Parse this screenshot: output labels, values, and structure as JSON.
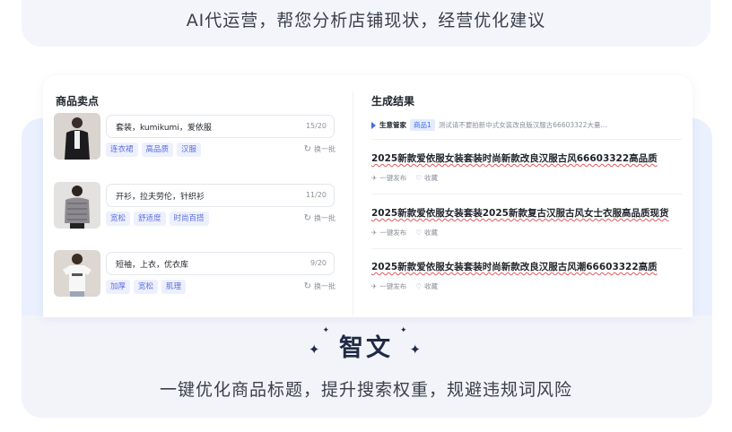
{
  "header": {
    "subtitle": "AI代运营，帮您分析店铺现状，经营优化建议"
  },
  "left_panel": {
    "title": "商品卖点",
    "swap_label": "换一批",
    "products": [
      {
        "keywords": "套装，kumikumi，爱依服",
        "count": "15/20",
        "tags": [
          "连衣裙",
          "高品质",
          "汉服"
        ]
      },
      {
        "keywords": "开衫，拉夫劳伦，针织衫",
        "count": "11/20",
        "tags": [
          "宽松",
          "舒适度",
          "时尚百搭"
        ]
      },
      {
        "keywords": "短袖，上衣，优衣库",
        "count": "9/20",
        "tags": [
          "加厚",
          "宽松",
          "肌理"
        ]
      }
    ]
  },
  "right_panel": {
    "title": "生成结果",
    "agent_name": "生意管家",
    "product_chip": "商品1",
    "prompt_preview": "测试请不要拍新中式女装改良版汉服古66603322大量...",
    "results": [
      {
        "title": "2025新款爱依服女装套装时尚新款改良汉服古风66603322高品质",
        "publish": "一键发布",
        "favorite": "收藏"
      },
      {
        "title": "2025新款爱依服女装套装2025新款复古汉服古风女士衣服高品质现货",
        "publish": "一键发布",
        "favorite": "收藏"
      },
      {
        "title": "2025新款爱依服女装套装时尚新款改良汉服古风潮66603322高质",
        "publish": "一键发布",
        "favorite": "收藏"
      }
    ]
  },
  "brand": {
    "name": "智文",
    "tagline": "一键优化商品标题，提升搜索权重，规避违规词风险"
  },
  "icons": {
    "swap": "refresh-icon",
    "publish": "send-icon",
    "favorite": "heart-icon",
    "sparkle": "sparkle-icon",
    "agent": "play-icon"
  },
  "colors": {
    "accent": "#3d6df2",
    "tag_bg": "#edf0fd",
    "tag_text": "#5b6ee1",
    "panel_bg": "#eaf0fd"
  }
}
